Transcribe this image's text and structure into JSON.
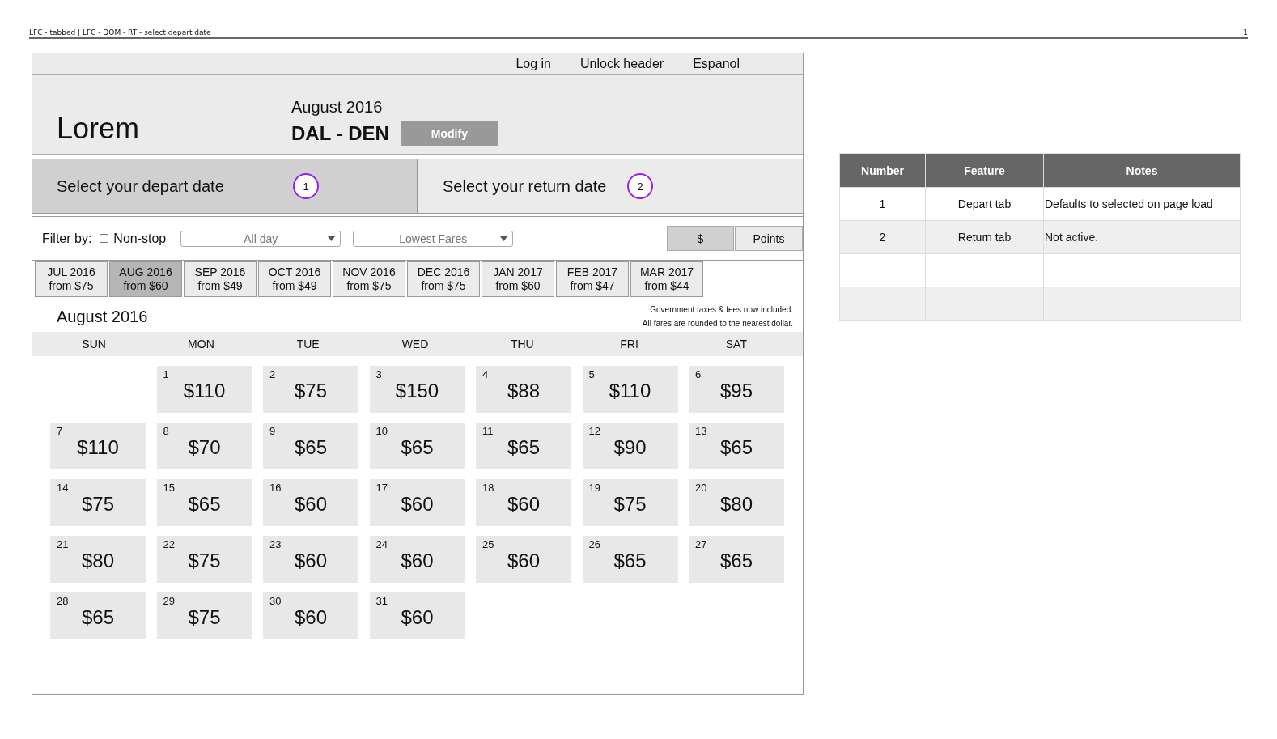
{
  "page_header": {
    "title": "LFC - tabbed | LFC - DOM - RT - select depart date",
    "page_number": "1"
  },
  "top_links": [
    "Log in",
    "Unlock header",
    "Espanol"
  ],
  "header": {
    "logo": "Lorem",
    "month": "August 2016",
    "route": "DAL - DEN",
    "modify_button": "Modify"
  },
  "trip_tabs": [
    {
      "label": "Select your depart date",
      "marker": "1",
      "selected": true
    },
    {
      "label": "Select your return date",
      "marker": "2",
      "selected": false
    }
  ],
  "filter": {
    "label": "Filter by:",
    "nonstop": {
      "label": "Non-stop",
      "checked": false
    },
    "time_select": "All day",
    "sort_select": "Lowest Fares",
    "currency": [
      {
        "label": "$",
        "selected": true
      },
      {
        "label": "Points",
        "selected": false
      }
    ]
  },
  "month_tabs": [
    {
      "month": "JUL 2016",
      "from": "from $75",
      "selected": false
    },
    {
      "month": "AUG 2016",
      "from": "from $60",
      "selected": true
    },
    {
      "month": "SEP 2016",
      "from": "from $49",
      "selected": false
    },
    {
      "month": "OCT 2016",
      "from": "from $49",
      "selected": false
    },
    {
      "month": "NOV 2016",
      "from": "from $75",
      "selected": false
    },
    {
      "month": "DEC 2016",
      "from": "from $75",
      "selected": false
    },
    {
      "month": "JAN 2017",
      "from": "from $60",
      "selected": false
    },
    {
      "month": "FEB 2017",
      "from": "from $47",
      "selected": false
    },
    {
      "month": "MAR 2017",
      "from": "from $44",
      "selected": false
    }
  ],
  "calendar": {
    "title": "August 2016",
    "notes": [
      "Government taxes & fees now included.",
      "All fares are rounded to the nearest dollar."
    ],
    "weekdays": [
      "SUN",
      "MON",
      "TUE",
      "WED",
      "THU",
      "FRI",
      "SAT"
    ],
    "weeks": [
      [
        {
          "kind": "blank"
        },
        {
          "day": "1",
          "price": "$110"
        },
        {
          "day": "2",
          "price": "$75"
        },
        {
          "day": "3",
          "price": "$150"
        },
        {
          "day": "4",
          "price": "$88"
        },
        {
          "day": "5",
          "price": "$110"
        },
        {
          "day": "6",
          "price": "$95"
        }
      ],
      [
        {
          "day": "7",
          "price": "$110"
        },
        {
          "day": "8",
          "price": "$70"
        },
        {
          "day": "9",
          "price": "$65"
        },
        {
          "day": "10",
          "price": "$65"
        },
        {
          "day": "11",
          "price": "$65"
        },
        {
          "day": "12",
          "price": "$90"
        },
        {
          "day": "13",
          "price": "$65"
        }
      ],
      [
        {
          "day": "14",
          "price": "$75"
        },
        {
          "day": "15",
          "price": "$65"
        },
        {
          "day": "16",
          "price": "$60"
        },
        {
          "day": "17",
          "price": "$60"
        },
        {
          "day": "18",
          "price": "$60"
        },
        {
          "day": "19",
          "price": "$75"
        },
        {
          "day": "20",
          "price": "$80"
        }
      ],
      [
        {
          "day": "21",
          "price": "$80"
        },
        {
          "day": "22",
          "price": "$75"
        },
        {
          "day": "23",
          "price": "$60"
        },
        {
          "day": "24",
          "price": "$60"
        },
        {
          "day": "25",
          "price": "$60"
        },
        {
          "day": "26",
          "price": "$65"
        },
        {
          "day": "27",
          "price": "$65"
        }
      ],
      [
        {
          "day": "28",
          "price": "$65"
        },
        {
          "day": "29",
          "price": "$75"
        },
        {
          "day": "30",
          "price": "$60"
        },
        {
          "day": "31",
          "price": "$60"
        }
      ]
    ]
  },
  "notes_table": {
    "columns": [
      "Number",
      "Feature",
      "Notes"
    ],
    "rows": [
      [
        "1",
        "Depart tab",
        "Defaults to selected on page load"
      ],
      [
        "2",
        "Return tab",
        "Not active."
      ],
      [],
      []
    ]
  }
}
